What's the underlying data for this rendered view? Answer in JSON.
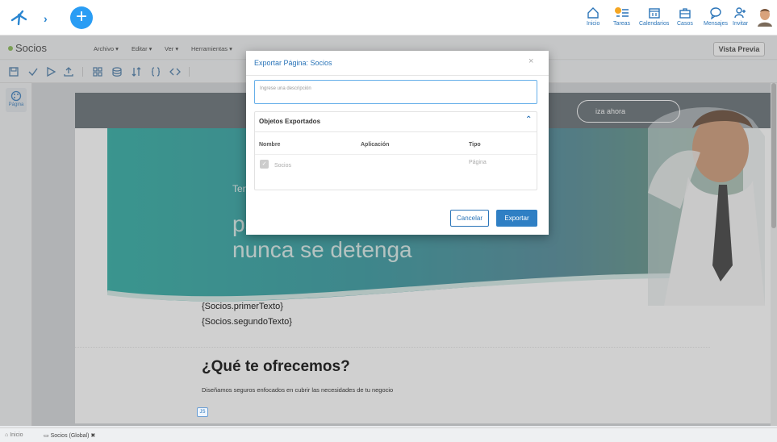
{
  "topnav": [
    {
      "label": "Inicio",
      "icon": "home-icon"
    },
    {
      "label": "Tareas",
      "icon": "tasks-icon",
      "badge_color": "#f5a623"
    },
    {
      "label": "Calendarios",
      "icon": "calendar-icon"
    },
    {
      "label": "Casos",
      "icon": "briefcase-icon"
    },
    {
      "label": "Mensajes",
      "icon": "message-icon"
    },
    {
      "label": "Invitar",
      "icon": "invite-user-icon"
    }
  ],
  "app": {
    "title": "Socios",
    "status_color": "#7cb342",
    "menus": [
      "Archivo ▾",
      "Editar ▾",
      "Ver ▾",
      "Herramientas ▾"
    ],
    "preview_button": "Vista Previa"
  },
  "leftbar": {
    "page_label": "Página"
  },
  "page": {
    "cta": "iza ahora",
    "hero_line1": "Tenemos",
    "hero_line2": "para",
    "hero_line3": "nunca se detenga",
    "var1": "{Socios.primerTexto}",
    "var2": "{Socios.segundoTexto}",
    "heading": "¿Qué te ofrecemos?",
    "desc": "Diseñamos seguros enfocados en cubrir las necesidades de tu negocio",
    "js_label": "JS"
  },
  "modal": {
    "title": "Exportar Página: Socios",
    "close": "×",
    "description_placeholder": "Ingrese una descripción",
    "section_title": "Objetos Exportados",
    "columns": {
      "name": "Nombre",
      "app": "Aplicación",
      "type": "Tipo"
    },
    "rows": [
      {
        "name": "Socios",
        "app": "",
        "type": "Página"
      }
    ],
    "cancel": "Cancelar",
    "export": "Exportar"
  },
  "bottom_tabs": [
    {
      "label": "Inicio",
      "icon": "home-icon"
    },
    {
      "label": "Socios (Global)",
      "icon": "page-icon",
      "close": "✖"
    }
  ],
  "colors": {
    "accent": "#2a74b8",
    "primary_button": "#2f7fc4",
    "brand_blue": "#2a9df4"
  }
}
